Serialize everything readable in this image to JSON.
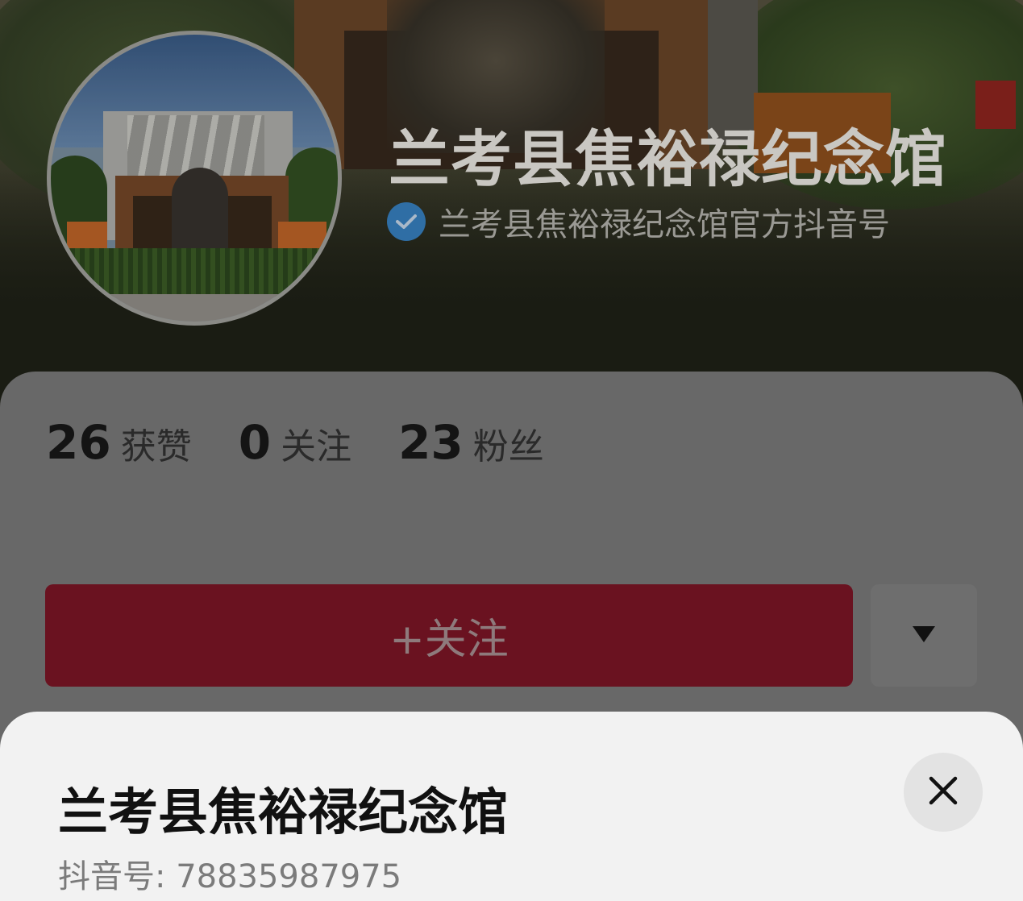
{
  "profile": {
    "name": "兰考县焦裕禄纪念馆",
    "verified_text": "兰考县焦裕禄纪念馆官方抖音号",
    "verified_icon": "verified-check-icon"
  },
  "stats": [
    {
      "value": "26",
      "label": "获赞"
    },
    {
      "value": "0",
      "label": "关注"
    },
    {
      "value": "23",
      "label": "粉丝"
    }
  ],
  "actions": {
    "follow_label": "+关注",
    "more_icon": "triangle-down-icon"
  },
  "sheet": {
    "title": "兰考县焦裕禄纪念馆",
    "id_text": "抖音号: 78835987975",
    "close_icon": "close-icon"
  },
  "colors": {
    "follow_button": "#6a1220",
    "verified_badge": "#2f6ea5",
    "sheet_background": "#f2f2f2"
  }
}
